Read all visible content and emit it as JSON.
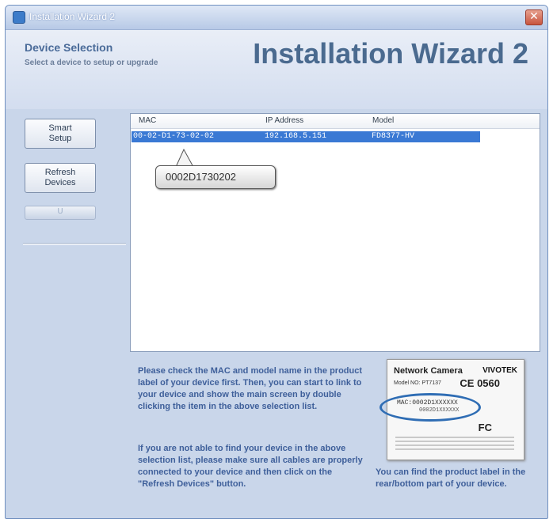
{
  "window": {
    "title": "Installation Wizard 2",
    "close_glyph": "✕"
  },
  "header": {
    "section_title": "Device Selection",
    "section_subtitle": "Select a device to setup or upgrade",
    "wizard_title": "Installation Wizard 2"
  },
  "sidebar": {
    "smart_setup_line1": "Smart",
    "smart_setup_line2": "Setup",
    "refresh_line1": "Refresh",
    "refresh_line2": "Devices",
    "disabled_label": "U"
  },
  "device_list": {
    "columns": [
      "MAC",
      "IP Address",
      "Model"
    ],
    "rows": [
      {
        "mac": "00-02-D1-73-02-02",
        "ip": "192.168.5.151",
        "model": "FD8377-HV"
      }
    ],
    "selected_row": 0
  },
  "callout": {
    "text": "0002D1730202"
  },
  "instructions": {
    "paragraph1": "Please check the MAC and model name in the product label of your device first. Then, you can start to link to your device and show the main screen by double clicking the item in the above selection list.",
    "paragraph2": "If you are not able to find your device in the above selection list, please make sure all cables are properly connected to your device and then click on the \"Refresh Devices\" button."
  },
  "product_label": {
    "title": "Network Camera",
    "brand": "VIVOTEK",
    "model_text": "Model NO: PT7137",
    "ce_text": "CE 0560",
    "mac_text": "MAC:0002D1XXXXXX",
    "mac_sub": "0002D1XXXXXX",
    "fc_text": "FC",
    "note": "You can find the product label in the rear/bottom part of your device."
  },
  "colors": {
    "accent": "#3a79d4",
    "info_text": "#3e5f9a",
    "window_bg": "#c9d6ea"
  }
}
